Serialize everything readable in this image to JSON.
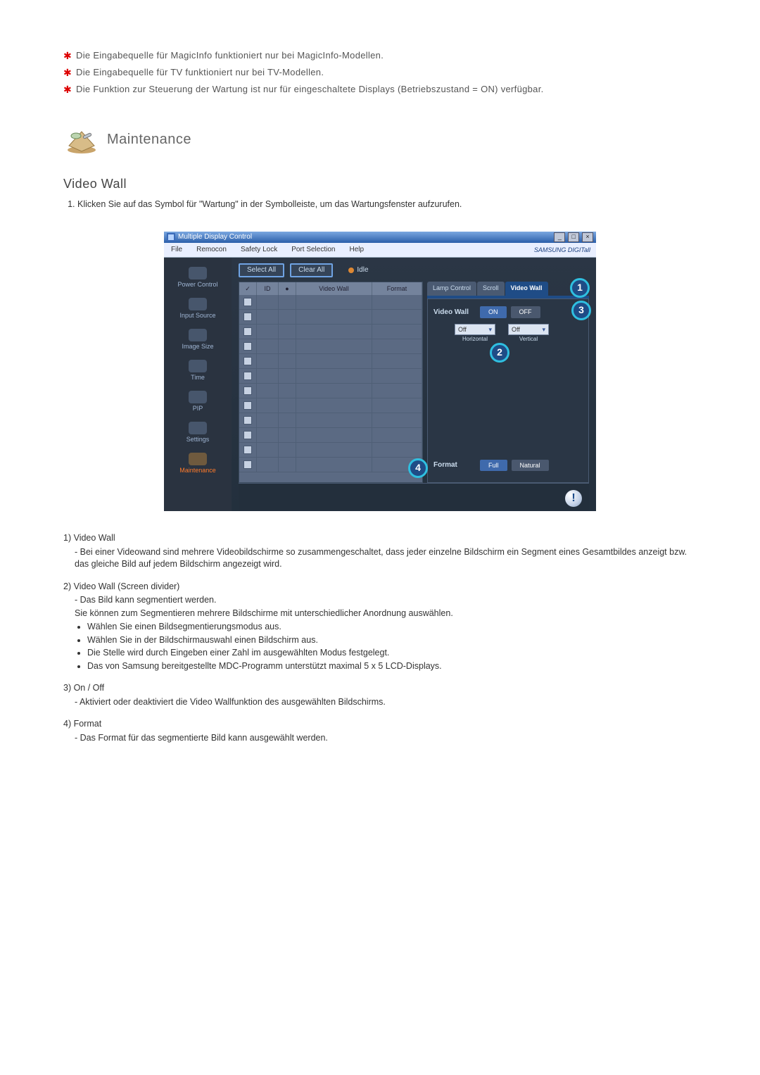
{
  "notes": [
    "Die Eingabequelle für MagicInfo funktioniert nur bei MagicInfo-Modellen.",
    "Die Eingabequelle für TV funktioniert nur bei TV-Modellen.",
    "Die Funktion zur Steuerung der Wartung ist nur für eingeschaltete Displays (Betriebszustand = ON) verfügbar."
  ],
  "section_title": "Maintenance",
  "subsection_title": "Video Wall",
  "intro_step": "Klicken Sie auf das Symbol für \"Wartung\" in der Symbolleiste, um das Wartungsfenster aufzurufen.",
  "app": {
    "window_title": "Multiple Display Control",
    "menu": [
      "File",
      "Remocon",
      "Safety Lock",
      "Port Selection",
      "Help"
    ],
    "brand": "SAMSUNG DIGITall",
    "sidebar": [
      {
        "label": "Power Control"
      },
      {
        "label": "Input Source"
      },
      {
        "label": "Image Size"
      },
      {
        "label": "Time"
      },
      {
        "label": "PIP"
      },
      {
        "label": "Settings"
      },
      {
        "label": "Maintenance"
      }
    ],
    "toolbar": {
      "select_all": "Select All",
      "clear_all": "Clear All",
      "idle": "Idle"
    },
    "grid_headers": {
      "c1": "✓",
      "c2": "ID",
      "c3": "●",
      "c4": "Video Wall",
      "c5": "Format"
    },
    "tabs": [
      "Lamp Control",
      "Scroll",
      "Video Wall"
    ],
    "pane": {
      "videowall_label": "Video Wall",
      "on": "ON",
      "off": "OFF",
      "horiz_sel": "Off",
      "vert_sel": "Off",
      "horiz_label": "Horizontal",
      "vert_label": "Vertical",
      "format_label": "Format",
      "full": "Full",
      "natural": "Natural"
    },
    "markers": {
      "m1": "1",
      "m2": "2",
      "m3": "3",
      "m4": "4"
    }
  },
  "desc": {
    "i1": {
      "t": "1)  Video Wall",
      "lines": [
        "- Bei einer Videowand sind mehrere Videobildschirme so zusammengeschaltet, dass jeder einzelne Bildschirm ein Segment eines Gesamtbildes anzeigt bzw. das gleiche Bild auf jedem Bildschirm angezeigt wird."
      ]
    },
    "i2": {
      "t": "2)  Video Wall (Screen divider)",
      "lines": [
        "- Das Bild kann segmentiert werden.",
        "Sie können zum Segmentieren mehrere Bildschirme mit unterschiedlicher Anordnung auswählen."
      ],
      "bullets": [
        "Wählen Sie einen Bildsegmentierungsmodus aus.",
        "Wählen Sie in der Bildschirmauswahl einen Bildschirm aus.",
        "Die Stelle wird durch Eingeben einer Zahl im ausgewählten Modus festgelegt.",
        "Das von Samsung bereitgestellte MDC-Programm unterstützt maximal 5 x 5 LCD-Displays."
      ]
    },
    "i3": {
      "t": "3)  On / Off",
      "lines": [
        "- Aktiviert oder deaktiviert die Video Wallfunktion des ausgewählten Bildschirms."
      ]
    },
    "i4": {
      "t": "4)  Format",
      "lines": [
        "- Das Format für das segmentierte Bild kann ausgewählt werden."
      ]
    }
  }
}
